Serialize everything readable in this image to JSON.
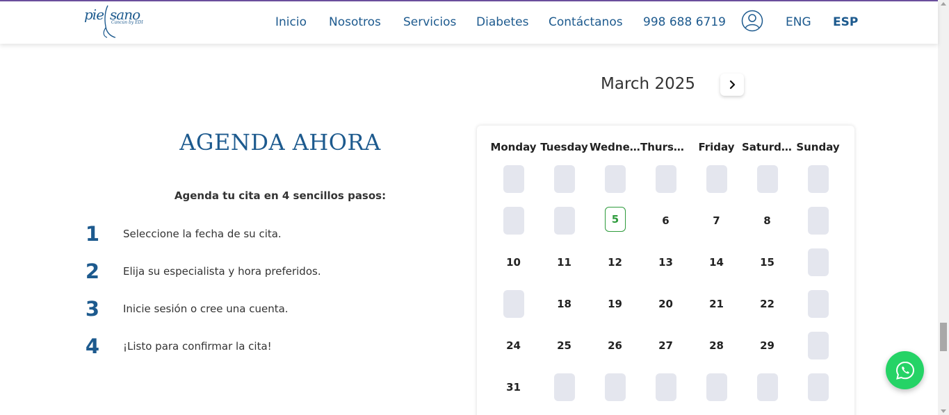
{
  "brand": {
    "logo_word_a": "pie",
    "logo_word_b": "sano",
    "logo_sub": "Cancún by EDI",
    "primary_color": "#1d5a8e",
    "accent_color": "#6b4f9e"
  },
  "nav": {
    "items": [
      {
        "label": "Inicio"
      },
      {
        "label": "Nosotros"
      },
      {
        "label": "Servicios"
      },
      {
        "label": "Diabetes"
      },
      {
        "label": "Contáctanos"
      },
      {
        "label": "998 688 6719"
      }
    ],
    "user_icon": "user-circle-icon",
    "lang_en": "ENG",
    "lang_es": "ESP",
    "active_lang": "ESP"
  },
  "main": {
    "heading": "AGENDA AHORA",
    "subheading": "Agenda tu cita en 4 sencillos pasos:",
    "steps": [
      {
        "number": "1",
        "text": "Seleccione la fecha de su cita."
      },
      {
        "number": "2",
        "text": "Elija su especialista y hora preferidos."
      },
      {
        "number": "3",
        "text": "Inicie sesión o cree una cuenta."
      },
      {
        "number": "4",
        "text": "¡Listo para confirmar la cita!"
      }
    ]
  },
  "calendar": {
    "month_label": "March 2025",
    "next_icon": "chevron-right-icon",
    "weekdays": [
      "Monday",
      "Tuesday",
      "Wednesday",
      "Thursday",
      "Friday",
      "Saturday",
      "Sunday"
    ],
    "weeks": [
      [
        null,
        null,
        null,
        null,
        null,
        null,
        null
      ],
      [
        null,
        null,
        "5",
        "6",
        "7",
        "8",
        null
      ],
      [
        "10",
        "11",
        "12",
        "13",
        "14",
        "15",
        null
      ],
      [
        null,
        "18",
        "19",
        "20",
        "21",
        "22",
        null
      ],
      [
        "24",
        "25",
        "26",
        "27",
        "28",
        "29",
        null
      ],
      [
        "31",
        null,
        null,
        null,
        null,
        null,
        null
      ]
    ],
    "today": "5",
    "today_color": "#2e9b3c"
  },
  "whatsapp": {
    "icon": "whatsapp-icon",
    "color": "#25d366"
  }
}
